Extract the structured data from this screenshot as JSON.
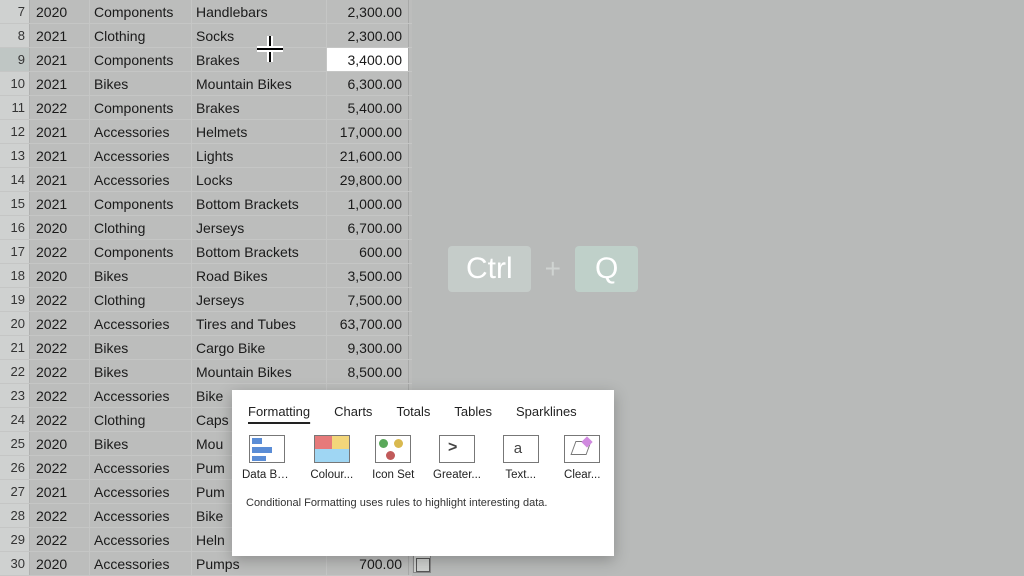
{
  "rows": [
    {
      "num": "7",
      "year": "2020",
      "cat": "Components",
      "sub": "Handlebars",
      "val": "2,300.00"
    },
    {
      "num": "8",
      "year": "2021",
      "cat": "Clothing",
      "sub": "Socks",
      "val": "2,300.00"
    },
    {
      "num": "9",
      "year": "2021",
      "cat": "Components",
      "sub": "Brakes",
      "val": "3,400.00",
      "selected": true
    },
    {
      "num": "10",
      "year": "2021",
      "cat": "Bikes",
      "sub": "Mountain Bikes",
      "val": "6,300.00"
    },
    {
      "num": "11",
      "year": "2022",
      "cat": "Components",
      "sub": "Brakes",
      "val": "5,400.00"
    },
    {
      "num": "12",
      "year": "2021",
      "cat": "Accessories",
      "sub": "Helmets",
      "val": "17,000.00"
    },
    {
      "num": "13",
      "year": "2021",
      "cat": "Accessories",
      "sub": "Lights",
      "val": "21,600.00"
    },
    {
      "num": "14",
      "year": "2021",
      "cat": "Accessories",
      "sub": "Locks",
      "val": "29,800.00"
    },
    {
      "num": "15",
      "year": "2021",
      "cat": "Components",
      "sub": "Bottom Brackets",
      "val": "1,000.00"
    },
    {
      "num": "16",
      "year": "2020",
      "cat": "Clothing",
      "sub": "Jerseys",
      "val": "6,700.00"
    },
    {
      "num": "17",
      "year": "2022",
      "cat": "Components",
      "sub": "Bottom Brackets",
      "val": "600.00"
    },
    {
      "num": "18",
      "year": "2020",
      "cat": "Bikes",
      "sub": "Road Bikes",
      "val": "3,500.00"
    },
    {
      "num": "19",
      "year": "2022",
      "cat": "Clothing",
      "sub": "Jerseys",
      "val": "7,500.00"
    },
    {
      "num": "20",
      "year": "2022",
      "cat": "Accessories",
      "sub": "Tires and Tubes",
      "val": "63,700.00"
    },
    {
      "num": "21",
      "year": "2022",
      "cat": "Bikes",
      "sub": "Cargo Bike",
      "val": "9,300.00"
    },
    {
      "num": "22",
      "year": "2022",
      "cat": "Bikes",
      "sub": "Mountain Bikes",
      "val": "8,500.00"
    },
    {
      "num": "23",
      "year": "2022",
      "cat": "Accessories",
      "sub": "Bike",
      "val": ""
    },
    {
      "num": "24",
      "year": "2022",
      "cat": "Clothing",
      "sub": "Caps",
      "val": ""
    },
    {
      "num": "25",
      "year": "2020",
      "cat": "Bikes",
      "sub": "Mou",
      "val": ""
    },
    {
      "num": "26",
      "year": "2022",
      "cat": "Accessories",
      "sub": "Pum",
      "val": ""
    },
    {
      "num": "27",
      "year": "2021",
      "cat": "Accessories",
      "sub": "Pum",
      "val": ""
    },
    {
      "num": "28",
      "year": "2022",
      "cat": "Accessories",
      "sub": "Bike",
      "val": ""
    },
    {
      "num": "29",
      "year": "2022",
      "cat": "Accessories",
      "sub": "Heln",
      "val": ""
    },
    {
      "num": "30",
      "year": "2020",
      "cat": "Accessories",
      "sub": "Pumps",
      "val": "700.00"
    }
  ],
  "keyhint": {
    "k1": "Ctrl",
    "plus": "+",
    "k2": "Q"
  },
  "popup": {
    "tabs": [
      "Formatting",
      "Charts",
      "Totals",
      "Tables",
      "Sparklines"
    ],
    "activeTab": 0,
    "items": [
      {
        "label": "Data Bars",
        "icon": "databars"
      },
      {
        "label": "Colour...",
        "icon": "colour"
      },
      {
        "label": "Icon Set",
        "icon": "iconset"
      },
      {
        "label": "Greater...",
        "icon": "greater"
      },
      {
        "label": "Text...",
        "icon": "textc"
      },
      {
        "label": "Clear...",
        "icon": "clear"
      }
    ],
    "footer": "Conditional Formatting uses rules to highlight interesting data."
  }
}
